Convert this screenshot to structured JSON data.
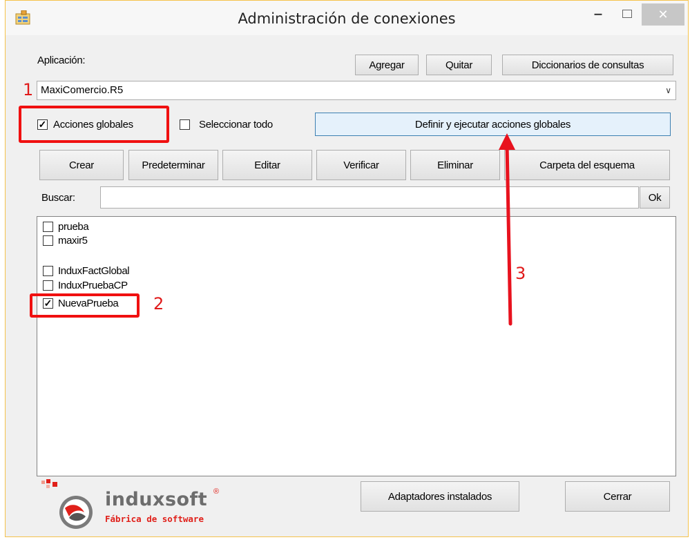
{
  "window": {
    "title": "Administración de conexiones"
  },
  "aplicacion": {
    "label": "Aplicación:",
    "selected": "MaxiComercio.R5",
    "buttons": {
      "agregar": "Agregar",
      "quitar": "Quitar",
      "diccionarios": "Diccionarios de consultas"
    }
  },
  "options": {
    "acciones_globales": "Acciones globales",
    "seleccionar_todo": "Seleccionar todo",
    "definir": "Definir y ejecutar acciones globales"
  },
  "toolbar": {
    "crear": "Crear",
    "predeterminar": "Predeterminar",
    "editar": "Editar",
    "verificar": "Verificar",
    "eliminar": "Eliminar",
    "carpeta": "Carpeta del esquema"
  },
  "search": {
    "label": "Buscar:",
    "value": "",
    "ok": "Ok"
  },
  "connections": [
    {
      "name": "prueba",
      "checked": false
    },
    {
      "name": "maxir5",
      "checked": false
    },
    {
      "name": "InduxFactGlobal",
      "checked": false
    },
    {
      "name": "InduxPruebaCP",
      "checked": false
    },
    {
      "name": "NuevaPrueba",
      "checked": true
    }
  ],
  "footer": {
    "adaptadores": "Adaptadores instalados",
    "cerrar": "Cerrar"
  },
  "logo": {
    "name": "induxsoft",
    "registered": "®",
    "tagline": "Fábrica de software"
  },
  "annotations": {
    "one": "1",
    "two": "2",
    "three": "3"
  },
  "colors": {
    "annotation": "#f01010",
    "accent_button": "#e5f1fb",
    "logo_red": "#e0201a"
  }
}
